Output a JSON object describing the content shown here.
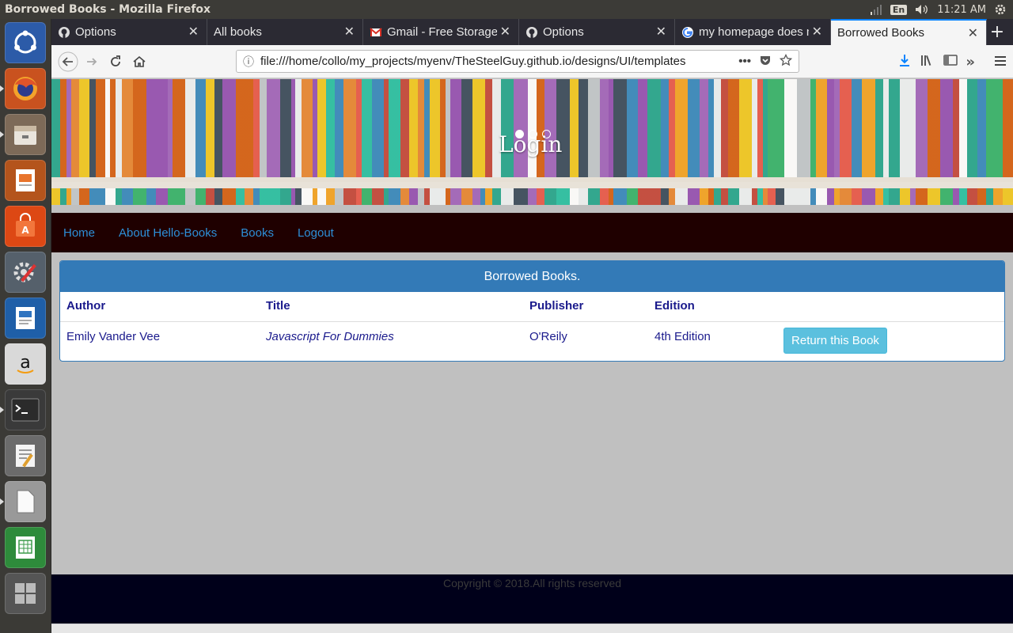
{
  "os": {
    "window_title": "Borrowed Books - Mozilla Firefox",
    "keyboard_layout": "En",
    "clock": "11:21 AM"
  },
  "browser": {
    "tabs": [
      {
        "label": "Options",
        "favicon": "github-icon",
        "active": false
      },
      {
        "label": "All books",
        "favicon": "none",
        "active": false
      },
      {
        "label": "Gmail - Free Storage",
        "favicon": "gmail-icon",
        "active": false
      },
      {
        "label": "Options",
        "favicon": "github-icon",
        "active": false
      },
      {
        "label": "my homepage does n",
        "favicon": "google-icon",
        "active": false
      },
      {
        "label": "Borrowed Books",
        "favicon": "none",
        "active": true
      }
    ],
    "url": "file:///home/collo/my_projects/myenv/TheSteelGuy.github.io/designs/UI/templates",
    "accent": "#0a84ff"
  },
  "site": {
    "hero_title": "Login",
    "nav": [
      "Home",
      "About Hello-Books",
      "Books",
      "Logout"
    ],
    "panel": {
      "heading": "Borrowed Books.",
      "columns": [
        "Author",
        "Title",
        "Publisher",
        "Edition"
      ],
      "rows": [
        {
          "author": "Emily Vander Vee",
          "title": "Javascript For Dummies",
          "publisher": "O'Reily",
          "edition": "4th Edition",
          "action": "Return this Book"
        }
      ]
    },
    "footer": "Copyright © 2018.All rights reserved",
    "colors": {
      "nav_bg": "#1f0000",
      "link": "#2d8fd8",
      "panel_head": "#337ab7",
      "button_info": "#5bc0de",
      "footer_bg": "#00001a",
      "page_bg": "#c0c0c0"
    }
  }
}
